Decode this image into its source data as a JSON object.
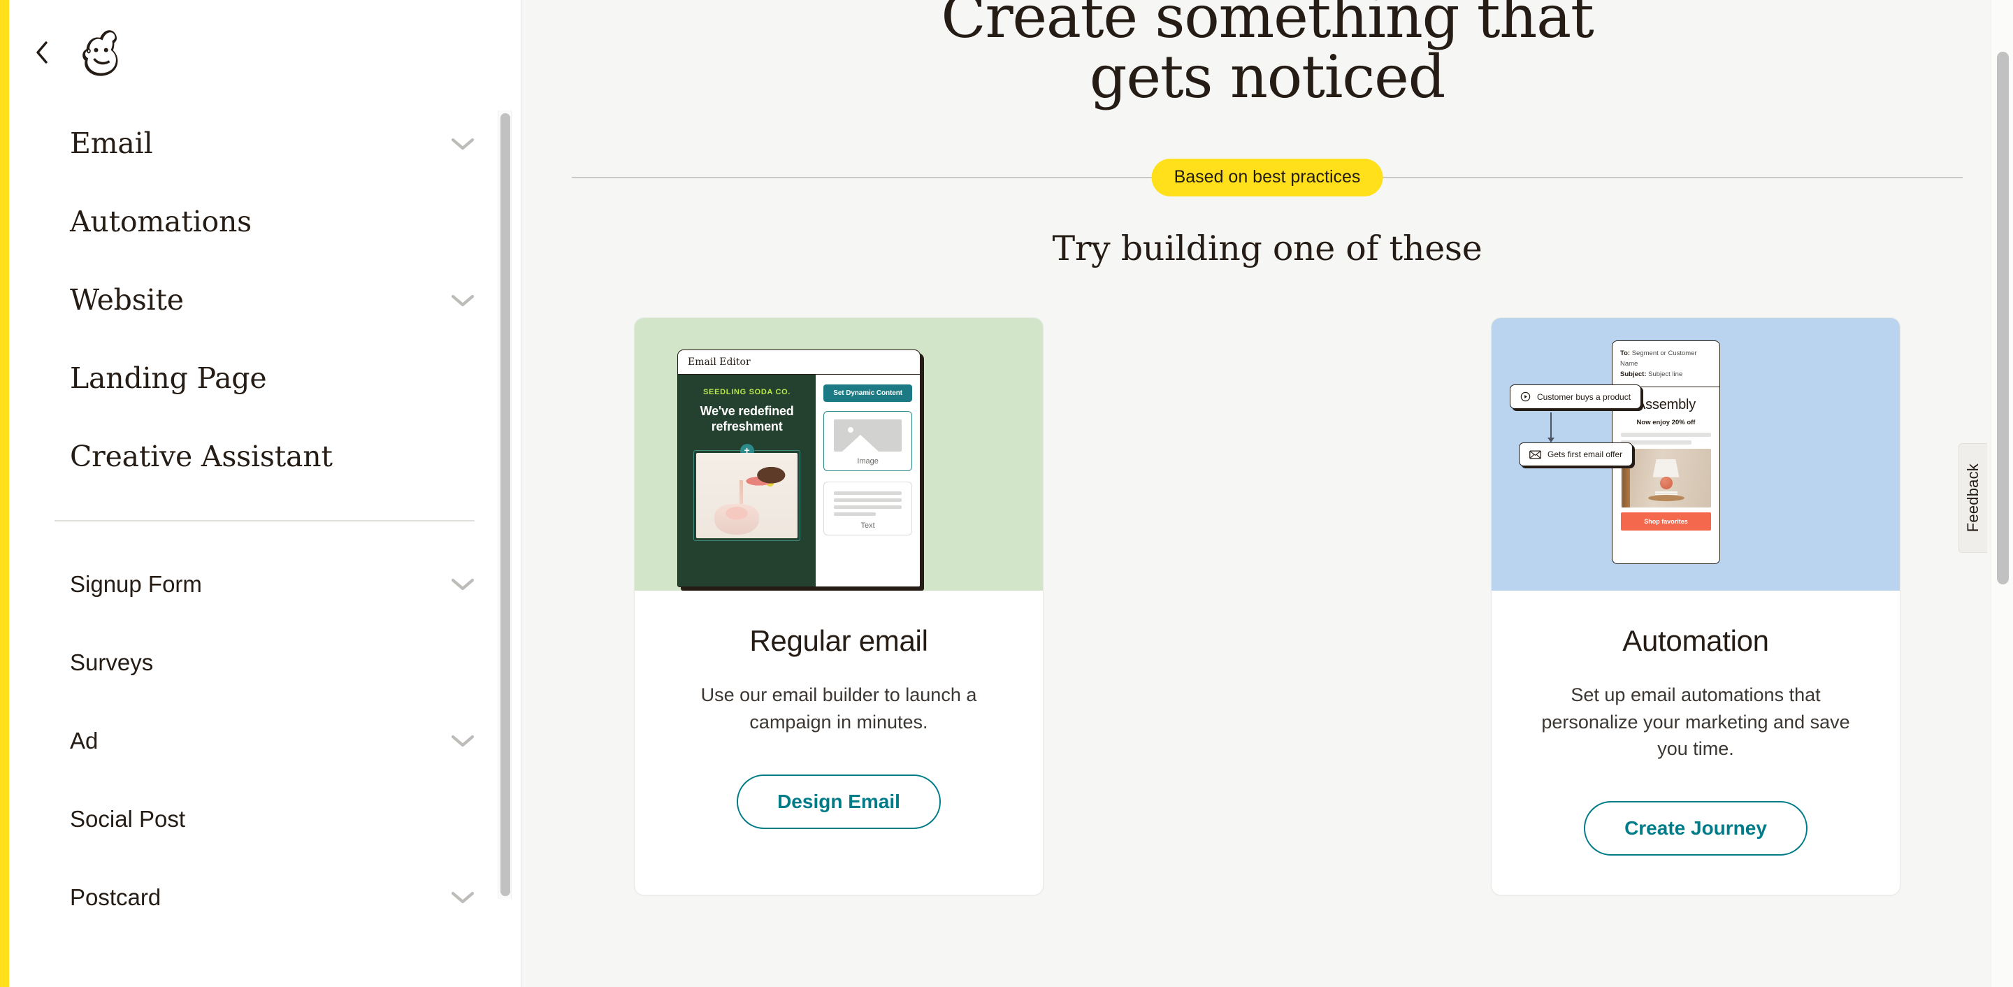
{
  "brand": {
    "logo_icon": "mailchimp-freddie-logo",
    "accent_yellow": "#FFE01B",
    "teal": "#007C89",
    "ink": "#241C15"
  },
  "sidebar": {
    "collapse_icon": "chevron-left-icon",
    "primary_items": [
      {
        "label": "Email",
        "expandable": true,
        "icon": "chevron-down-icon"
      },
      {
        "label": "Automations",
        "expandable": false,
        "icon": ""
      },
      {
        "label": "Website",
        "expandable": true,
        "icon": "chevron-down-icon"
      },
      {
        "label": "Landing Page",
        "expandable": false,
        "icon": ""
      },
      {
        "label": "Creative Assistant",
        "expandable": false,
        "icon": ""
      }
    ],
    "secondary_items": [
      {
        "label": "Signup Form",
        "expandable": true,
        "icon": "chevron-down-icon"
      },
      {
        "label": "Surveys",
        "expandable": false,
        "icon": ""
      },
      {
        "label": "Ad",
        "expandable": true,
        "icon": "chevron-down-icon"
      },
      {
        "label": "Social Post",
        "expandable": false,
        "icon": ""
      },
      {
        "label": "Postcard",
        "expandable": true,
        "icon": "chevron-down-icon"
      }
    ]
  },
  "hero": {
    "title_line1": "Create something that",
    "title_line2": "gets noticed",
    "badge": "Based on best practices",
    "subhead": "Try building one of these"
  },
  "cards": [
    {
      "title": "Regular email",
      "description": "Use our email builder to launch a campaign in minutes.",
      "cta": "Design Email",
      "thumb_bg": "#D3E5C8",
      "mock": {
        "window_title": "Email Editor",
        "brand_line": "SEEDLING SODA CO.",
        "headline": "We've redefined refreshment",
        "dynamic_button": "Set Dynamic Content",
        "block_image_label": "Image",
        "block_text_label": "Text",
        "add_icon": "plus-circle-icon",
        "image_placeholder_icon": "image-placeholder-icon"
      }
    },
    {
      "title": "Automation",
      "description": "Set up email automations that personalize your marketing and save you time.",
      "cta": "Create Journey",
      "thumb_bg": "#BAD3EF",
      "mock": {
        "to_label": "To:",
        "to_value": "Segment or Customer Name",
        "subject_label": "Subject:",
        "subject_value": "Subject line",
        "brand": "Assembly",
        "offer": "Now enjoy 20% off",
        "cta": "Shop favorites",
        "nodes": [
          {
            "label": "Customer buys a product",
            "icon": "play-circle-icon"
          },
          {
            "label": "Gets first email offer",
            "icon": "envelope-icon"
          }
        ]
      }
    }
  ],
  "feedback": {
    "label": "Feedback"
  }
}
